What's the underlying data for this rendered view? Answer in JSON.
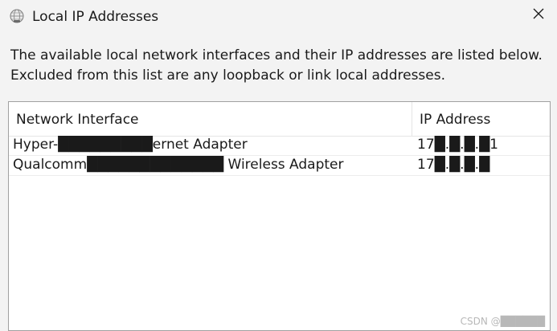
{
  "window": {
    "title": "Local IP Addresses",
    "icon": "network-globe-icon",
    "close_icon": "close-icon"
  },
  "description": {
    "line1": "The available local network interfaces and their IP addresses are listed below.",
    "line2": "Excluded from this list are any loopback or link local addresses."
  },
  "table": {
    "columns": [
      "Network Interface",
      "IP Address"
    ],
    "rows": [
      {
        "interface": "Hyper-█████████ernet Adapter",
        "ip": "17█.█.█.█1"
      },
      {
        "interface": "Qualcomm█████████████ Wireless Adapter",
        "ip": "17█.█.█.█"
      }
    ]
  },
  "watermark": "CSDN @██████"
}
